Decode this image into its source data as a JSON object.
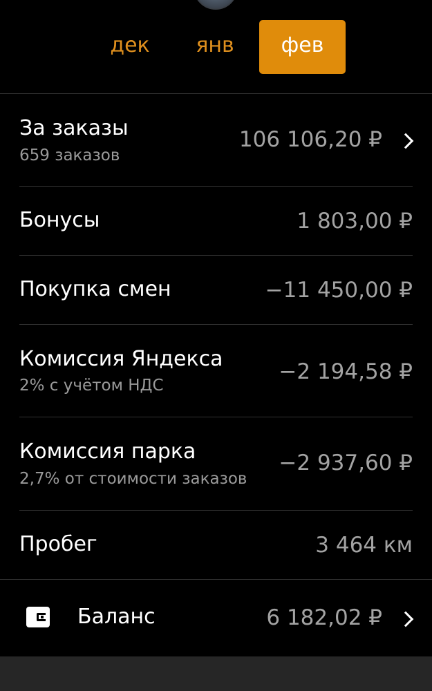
{
  "tabs": {
    "dec": "дек",
    "jan": "янв",
    "feb": "фев",
    "active": "фев"
  },
  "orders": {
    "title": "За заказы",
    "subtitle": "659 заказов",
    "value": "106 106,20 ₽"
  },
  "bonuses": {
    "title": "Бонусы",
    "value": "1 803,00 ₽"
  },
  "shifts": {
    "title": "Покупка смен",
    "value": "−11 450,00 ₽"
  },
  "yandex_commission": {
    "title": "Комиссия Яндекса",
    "subtitle": "2% с учётом НДС",
    "value": "−2 194,58 ₽"
  },
  "park_commission": {
    "title": "Комиссия парка",
    "subtitle": "2,7% от стоимости заказов",
    "value": "−2 937,60 ₽"
  },
  "mileage": {
    "title": "Пробег",
    "value": "3 464 км"
  },
  "balance": {
    "title": "Баланс",
    "value": "6 182,02 ₽",
    "icon": "wallet-icon"
  },
  "colors": {
    "accent": "#e08c0b",
    "background": "#000000",
    "divider": "#333333",
    "value_text": "#a3a3a3",
    "subtitle_text": "#9a9a9a"
  }
}
